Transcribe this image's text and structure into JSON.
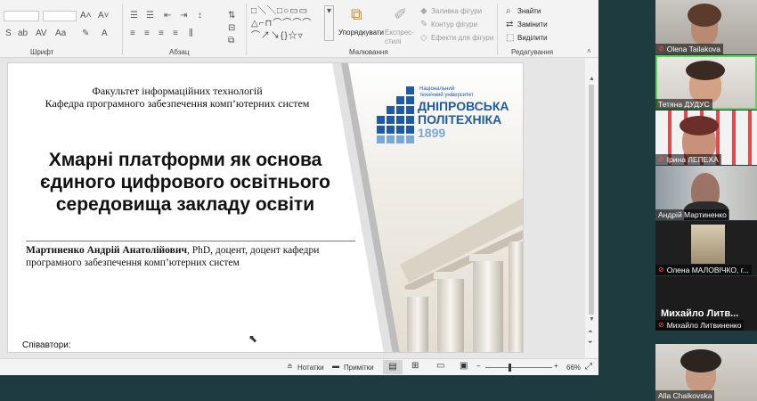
{
  "ribbon": {
    "groups": [
      "Шрифт",
      "Абзац",
      "Малювання",
      "Редагування"
    ],
    "arrange_label": "Упорядкувати",
    "express_styles_label": "Експрес-стилі",
    "shape_fill": "Заливка фігури",
    "shape_outline": "Контур фігури",
    "shape_effects": "Ефекти для фігури",
    "find": "Знайти",
    "replace": "Замінити",
    "select": "Виділити"
  },
  "slide": {
    "faculty_line1": "Факультет інформаційних технологій",
    "faculty_line2": "Кафедра програмного забезпечення комп’ютерних систем",
    "title_line1": "Хмарні платформи як основа",
    "title_line2": "єдиного цифрового освітнього",
    "title_line3": "середовища закладу освіти",
    "author_name": "Мартиненко Андрій Анатолійович",
    "author_rest_line1": ", PhD, доцент, доцент кафедри",
    "author_line2": "програмного забезпечення комп’ютерних систем",
    "coauthors_label": "Співавтори:",
    "logo_small_line1": "Національний",
    "logo_small_line2": "технічний університет",
    "logo_name_line1": "ДНІПРОВСЬКА",
    "logo_name_line2": "ПОЛІТЕХНІКА",
    "logo_year": "1899"
  },
  "statusbar": {
    "notes": "Нотатки",
    "comments": "Примітки",
    "zoom": "66%"
  },
  "participants": [
    {
      "name": "Olena Tailakova",
      "muted": true
    },
    {
      "name": "Тетяна ДУДУС",
      "muted": false
    },
    {
      "name": "Ірина ЛЕПЕХА",
      "muted": true
    },
    {
      "name": "Андрій Мартиненко",
      "muted": false
    },
    {
      "name": "Олена МАЛОВІЧКО, г...",
      "muted": true
    },
    {
      "name": "Михайло Литвиненко",
      "muted": true,
      "display_name": "Михайло  Литв..."
    },
    {
      "name": "Alla Chaikovska",
      "muted": false
    }
  ],
  "colors": {
    "logo_blue": "#1f5aa6",
    "active_speaker": "#5fd35f",
    "mic_muted": "#ff4d4d"
  }
}
